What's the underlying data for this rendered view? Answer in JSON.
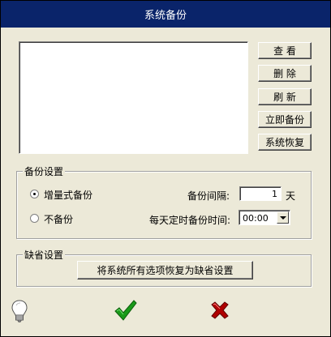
{
  "window": {
    "title": "系统备份"
  },
  "side_buttons": {
    "view": "查 看",
    "delete": "删 除",
    "refresh": "刷 新",
    "backup_now": "立即备份",
    "restore": "系统恢复"
  },
  "backup_settings": {
    "group_title": "备份设置",
    "incremental_label": "增量式备份",
    "no_backup_label": "不备份",
    "interval_label": "备份间隔:",
    "interval_value": "1",
    "interval_unit": "天",
    "daily_time_label": "每天定时备份时间:",
    "daily_time_value": "00:00",
    "selected_mode": "incremental"
  },
  "default_settings": {
    "group_title": "缺省设置",
    "restore_defaults_button": "将系统所有选项恢复为缺省设置"
  },
  "footer": {
    "help_icon": "lightbulb-icon",
    "ok_icon": "green-checkmark-icon",
    "cancel_icon": "red-x-icon",
    "ok_color": "#1a9a1a",
    "cancel_color": "#b00000"
  }
}
